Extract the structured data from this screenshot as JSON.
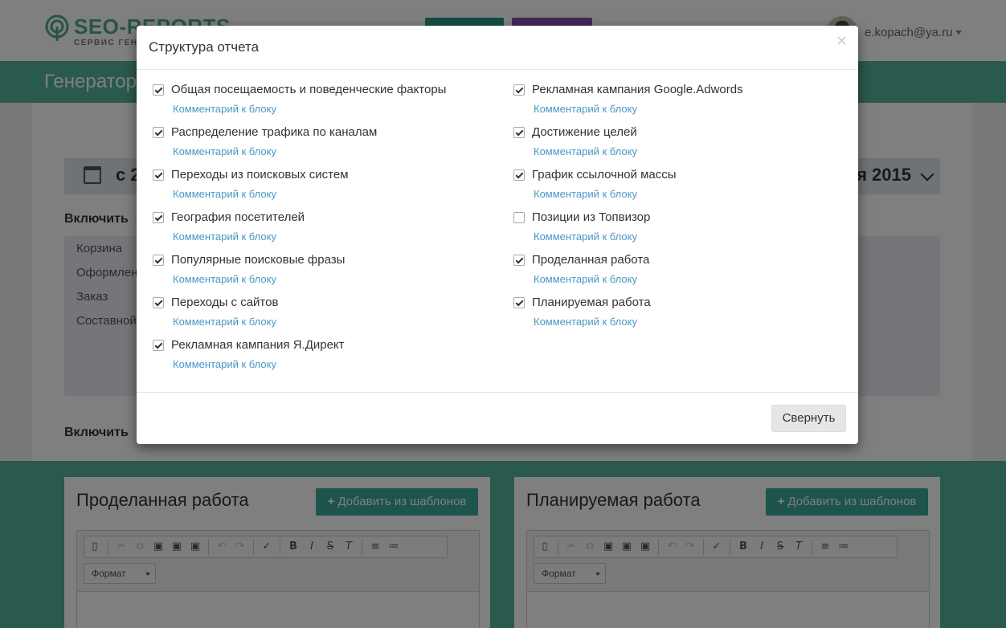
{
  "header": {
    "logo_title": "SEO-REPORTS",
    "logo_subtitle": "СЕРВИС ГЕНЕ",
    "user_email": "e.kopach@ya.ru"
  },
  "page": {
    "title": "Генератор",
    "date_from": "с 2",
    "date_to": "я 2015",
    "include_label_1": "Включить",
    "include_label_2": "Включить",
    "list_items": [
      "Корзина",
      "Оформлен",
      "Заказ",
      "Составной"
    ]
  },
  "work_panels": {
    "done": {
      "title": "Проделанная работа",
      "add_label": "Добавить из шаблонов",
      "format_label": "Формат"
    },
    "planned": {
      "title": "Планируемая работа",
      "add_label": "Добавить из шаблонов",
      "format_label": "Формат"
    }
  },
  "modal": {
    "title": "Структура отчета",
    "close_glyph": "×",
    "collapse_label": "Свернуть",
    "comment_link": "Комментарий к блоку",
    "left_blocks": [
      {
        "label": "Общая посещаемость и поведенческие факторы",
        "checked": true
      },
      {
        "label": "Распределение трафика по каналам",
        "checked": true
      },
      {
        "label": "Переходы из поисковых систем",
        "checked": true
      },
      {
        "label": "География посетителей",
        "checked": true
      },
      {
        "label": "Популярные поисковые фразы",
        "checked": true
      },
      {
        "label": "Переходы с сайтов",
        "checked": true
      },
      {
        "label": "Рекламная кампания Я.Директ",
        "checked": true
      }
    ],
    "right_blocks": [
      {
        "label": "Рекламная кампания Google.Adwords",
        "checked": true
      },
      {
        "label": "Достижение целей",
        "checked": true
      },
      {
        "label": "График ссылочной массы",
        "checked": true
      },
      {
        "label": "Позиции из Топвизор",
        "checked": false
      },
      {
        "label": "Проделанная работа",
        "checked": true
      },
      {
        "label": "Планируемая работа",
        "checked": true
      }
    ]
  }
}
